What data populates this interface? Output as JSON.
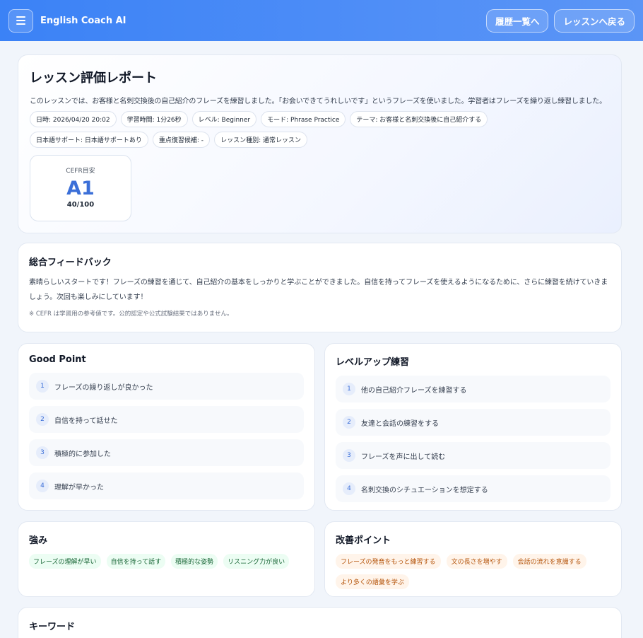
{
  "header": {
    "app_title": "English Coach AI",
    "history_button": "履歴一覧へ",
    "back_button": "レッスンへ戻る"
  },
  "report": {
    "title": "レッスン評価レポート",
    "summary": "このレッスンでは、お客様と名刺交換後の自己紹介のフレーズを練習しました。「お会いできてうれしいです」というフレーズを使いました。学習者はフレーズを繰り返し練習しました。",
    "chips": [
      "日時: 2026/04/20 20:02",
      "学習時間: 1分26秒",
      "レベル: Beginner",
      "モード: Phrase Practice",
      "テーマ: お客様と名刺交換後に自己紹介する",
      "日本語サポート: 日本語サポートあり",
      "重点復習候補: -",
      "レッスン種別: 通常レッスン"
    ],
    "cefr": {
      "label": "CEFR目安",
      "level": "A1",
      "score": "40/100"
    }
  },
  "feedback": {
    "title": "総合フィードバック",
    "text": "素晴らしいスタートです！フレーズの練習を通じて、自己紹介の基本をしっかりと学ぶことができました。自信を持ってフレーズを使えるようになるために、さらに練習を続けていきましょう。次回も楽しみにしています！",
    "note": "※ CEFR は学習用の参考値です。公的認定や公式試験結果ではありません。"
  },
  "good_point": {
    "title": "Good Point",
    "items": [
      {
        "num": "1",
        "text": "フレーズの繰り返しが良かった"
      },
      {
        "num": "2",
        "text": "自信を持って話せた"
      },
      {
        "num": "3",
        "text": "積極的に参加した"
      },
      {
        "num": "4",
        "text": "理解が早かった"
      }
    ]
  },
  "level_up": {
    "title": "レベルアップ練習",
    "items": [
      {
        "num": "1",
        "text": "他の自己紹介フレーズを練習する"
      },
      {
        "num": "2",
        "text": "友達と会話の練習をする"
      },
      {
        "num": "3",
        "text": "フレーズを声に出して読む"
      },
      {
        "num": "4",
        "text": "名刺交換のシチュエーションを想定する"
      }
    ]
  },
  "strengths": {
    "title": "強み",
    "tags": [
      "フレーズの理解が早い",
      "自信を持って話す",
      "積極的な姿勢",
      "リスニング力が良い"
    ]
  },
  "improvements": {
    "title": "改善ポイント",
    "tags": [
      "フレーズの発音をもっと練習する",
      "文の長さを増やす",
      "会話の流れを意識する",
      "より多くの語彙を学ぶ"
    ]
  },
  "keywords": {
    "title": "キーワード"
  }
}
